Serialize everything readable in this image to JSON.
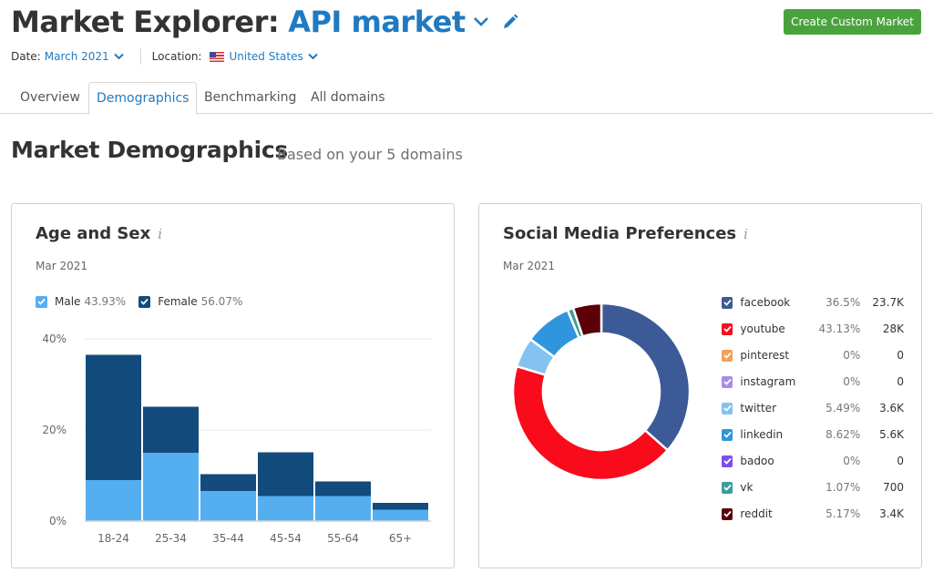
{
  "header": {
    "title_prefix": "Market Explorer:",
    "market_name": "API market",
    "create_button": "Create Custom Market"
  },
  "filters": {
    "date_label": "Date:",
    "date_value": "March 2021",
    "location_label": "Location:",
    "location_value": "United States"
  },
  "tabs": [
    {
      "label": "Overview",
      "active": false
    },
    {
      "label": "Demographics",
      "active": true
    },
    {
      "label": "Benchmarking",
      "active": false
    },
    {
      "label": "All domains",
      "active": false
    }
  ],
  "section": {
    "title": "Market Demographics",
    "subtitle": "Based on your 5 domains"
  },
  "age_sex": {
    "title": "Age and Sex",
    "date": "Mar 2021",
    "legend": [
      {
        "name": "Male",
        "pct": "43.93%",
        "color": "#55aef0"
      },
      {
        "name": "Female",
        "pct": "56.07%",
        "color": "#124b7c"
      }
    ]
  },
  "social": {
    "title": "Social Media Preferences",
    "date": "Mar 2021"
  },
  "chart_data": [
    {
      "type": "bar",
      "stacked": true,
      "title": "Age and Sex",
      "categories": [
        "18-24",
        "25-34",
        "35-44",
        "45-54",
        "55-64",
        "65+"
      ],
      "series": [
        {
          "name": "Male",
          "color": "#55aef0",
          "values": [
            9.0,
            15.0,
            6.6,
            5.5,
            5.5,
            2.5
          ]
        },
        {
          "name": "Female",
          "color": "#124b7c",
          "values": [
            27.5,
            10.1,
            3.7,
            9.6,
            3.2,
            1.5
          ]
        }
      ],
      "yticks": [
        "0%",
        "20%",
        "40%"
      ],
      "ytick_values": [
        0,
        20,
        40
      ],
      "ylim": [
        0,
        40
      ],
      "grid": true,
      "legend": "top-left"
    },
    {
      "type": "pie",
      "donut": true,
      "title": "Social Media Preferences",
      "slices": [
        {
          "name": "facebook",
          "pct_label": "36.5%",
          "value": 36.5,
          "count": "23.7K",
          "color": "#3c5a98"
        },
        {
          "name": "youtube",
          "pct_label": "43.13%",
          "value": 43.13,
          "count": "28K",
          "color": "#fa0b1b"
        },
        {
          "name": "pinterest",
          "pct_label": "0%",
          "value": 0,
          "count": "0",
          "color": "#f2a05a"
        },
        {
          "name": "instagram",
          "pct_label": "0%",
          "value": 0,
          "count": "0",
          "color": "#a98ce6"
        },
        {
          "name": "twitter",
          "pct_label": "5.49%",
          "value": 5.49,
          "count": "3.6K",
          "color": "#85c2ef"
        },
        {
          "name": "linkedin",
          "pct_label": "8.62%",
          "value": 8.62,
          "count": "5.6K",
          "color": "#2f95dc"
        },
        {
          "name": "badoo",
          "pct_label": "0%",
          "value": 0,
          "count": "0",
          "color": "#7c4ef0"
        },
        {
          "name": "vk",
          "pct_label": "1.07%",
          "value": 1.07,
          "count": "700",
          "color": "#3a9e9c"
        },
        {
          "name": "reddit",
          "pct_label": "5.17%",
          "value": 5.17,
          "count": "3.4K",
          "color": "#5c0009"
        }
      ],
      "legend": "right"
    }
  ]
}
